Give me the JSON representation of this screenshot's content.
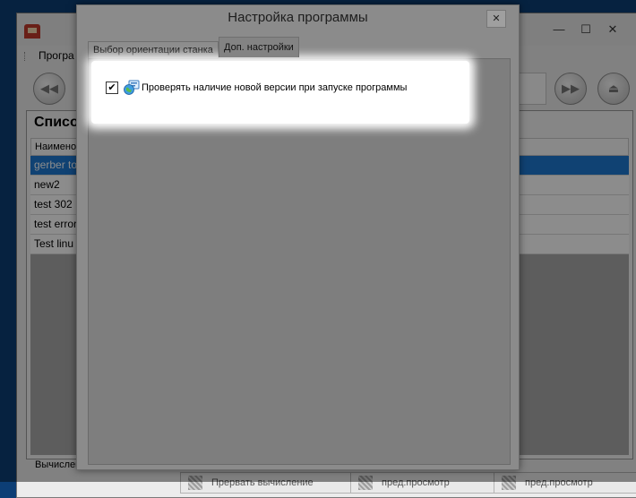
{
  "background_app": {
    "menu": {
      "first_item": "Програ"
    },
    "window_controls": {
      "minimize": "—",
      "maximize": "☐",
      "close": "✕"
    },
    "nav_buttons": {
      "back": "◀◀",
      "forward": "▶▶",
      "eject": "⏏"
    },
    "list": {
      "title": "Списо",
      "column_header": "Наимено",
      "rows": [
        "gerber to",
        "new2",
        "test 302",
        "test error",
        "Test linu"
      ],
      "selected_index": 0
    },
    "status": {
      "label": "Вычислен",
      "buttons": [
        "Прервать вычисление",
        "пред.просмотр",
        "пред.просмотр"
      ]
    }
  },
  "dialog": {
    "title": "Настройка программы",
    "close_glyph": "✕",
    "tabs": [
      {
        "label": "Выбор ориентации станка",
        "active": false
      },
      {
        "label": "Доп. настройки",
        "active": true
      }
    ],
    "options": {
      "check_updates": {
        "label": "Проверять наличие новой версии при запуске программы",
        "checked": true,
        "check_glyph": "✔"
      }
    }
  },
  "colors": {
    "desktop": "#0c3e75",
    "selection": "#1e78d2",
    "highlight": "#ffffff"
  }
}
